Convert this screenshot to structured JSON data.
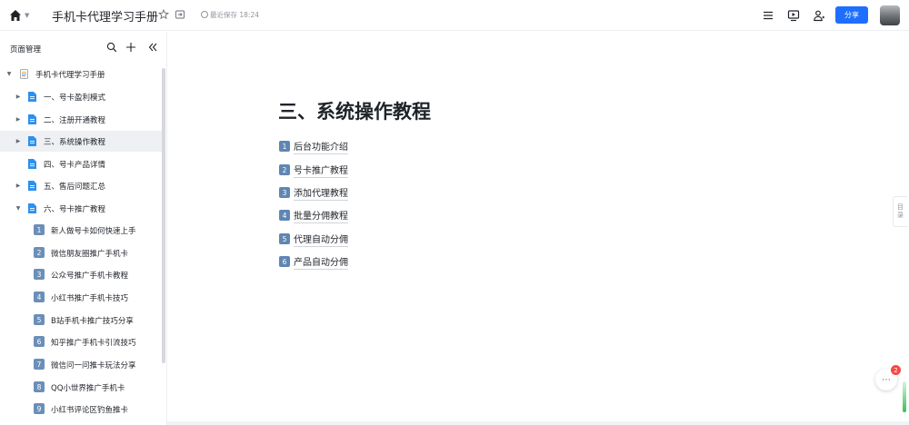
{
  "topbar": {
    "home_icon": "home-icon",
    "title": "手机卡代理学习手册",
    "saved_text": "最近保存 18:24",
    "share_label": "分享",
    "icons": [
      "star-icon",
      "move-icon",
      "saved-check-icon",
      "menu-icon",
      "present-icon",
      "collaborators-icon"
    ]
  },
  "sidebar": {
    "title": "页面管理",
    "root": {
      "label": "手机卡代理学习手册"
    },
    "items": [
      {
        "label": "一、号卡盈利模式",
        "expandable": true
      },
      {
        "label": "二、注册开通教程",
        "expandable": true
      },
      {
        "label": "三、系统操作教程",
        "expandable": true,
        "active": true
      },
      {
        "label": "四、号卡产品详情",
        "expandable": false
      },
      {
        "label": "五、售后问题汇总",
        "expandable": true
      },
      {
        "label": "六、号卡推广教程",
        "expandable": true,
        "expanded": true
      }
    ],
    "children": [
      {
        "num": "1",
        "label": "新人做号卡如何快速上手"
      },
      {
        "num": "2",
        "label": "微信朋友圈推广手机卡"
      },
      {
        "num": "3",
        "label": "公众号推广手机卡教程"
      },
      {
        "num": "4",
        "label": "小红书推广手机卡技巧"
      },
      {
        "num": "5",
        "label": "B站手机卡推广技巧分享"
      },
      {
        "num": "6",
        "label": "知乎推广手机卡引流技巧"
      },
      {
        "num": "7",
        "label": "微信问一问推卡玩法分享"
      },
      {
        "num": "8",
        "label": "QQ小世界推广手机卡"
      },
      {
        "num": "9",
        "label": "小红书评论区钓鱼推卡"
      }
    ]
  },
  "main": {
    "heading": "三、系统操作教程",
    "toc": [
      {
        "num": "1",
        "label": "后台功能介绍"
      },
      {
        "num": "2",
        "label": "号卡推广教程"
      },
      {
        "num": "3",
        "label": "添加代理教程"
      },
      {
        "num": "4",
        "label": "批量分佣教程"
      },
      {
        "num": "5",
        "label": "代理自动分佣"
      },
      {
        "num": "6",
        "label": "产品自动分佣"
      }
    ]
  },
  "outline_tab": {
    "line1": "目",
    "line2": "录"
  },
  "chat": {
    "badge": "2",
    "icon": "more-icon"
  },
  "colors": {
    "accent": "#1e6fff",
    "doc_icon": "#2b90f0",
    "badge_red": "#f54a45"
  }
}
